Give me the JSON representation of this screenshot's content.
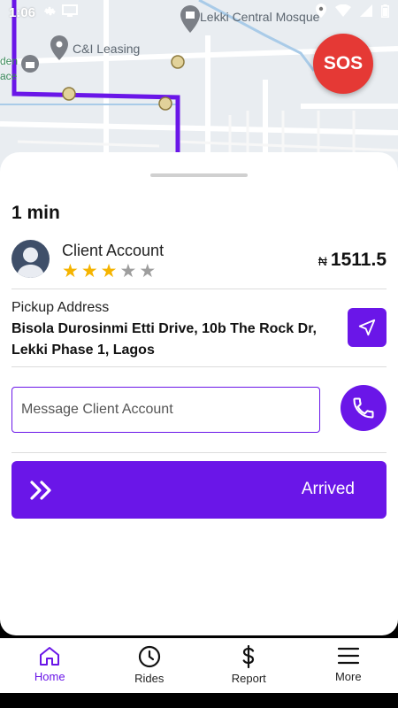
{
  "status_bar": {
    "time": "1:06"
  },
  "map": {
    "labels": {
      "mosque": "Lekki Central Mosque",
      "leasing": "C&I Leasing",
      "left_top": "den",
      "left_bottom": "ace"
    }
  },
  "sos": {
    "label": "SOS"
  },
  "trip": {
    "eta": "1 min",
    "client_name": "Client Account",
    "rating": 3,
    "rating_max": 5,
    "currency": "₦",
    "amount": "1511.5"
  },
  "pickup": {
    "label": "Pickup Address",
    "address": "Bisola Durosinmi Etti Drive, 10b The Rock Dr, Lekki Phase 1, Lagos"
  },
  "message": {
    "placeholder": "Message Client Account"
  },
  "arrived": {
    "label": "Arrived"
  },
  "bottom_nav": {
    "home": "Home",
    "rides": "Rides",
    "report": "Report",
    "more": "More"
  },
  "colors": {
    "accent": "#6a16e8",
    "sos": "#e53935",
    "star_filled": "#f5b400",
    "star_empty": "#9e9e9e"
  }
}
